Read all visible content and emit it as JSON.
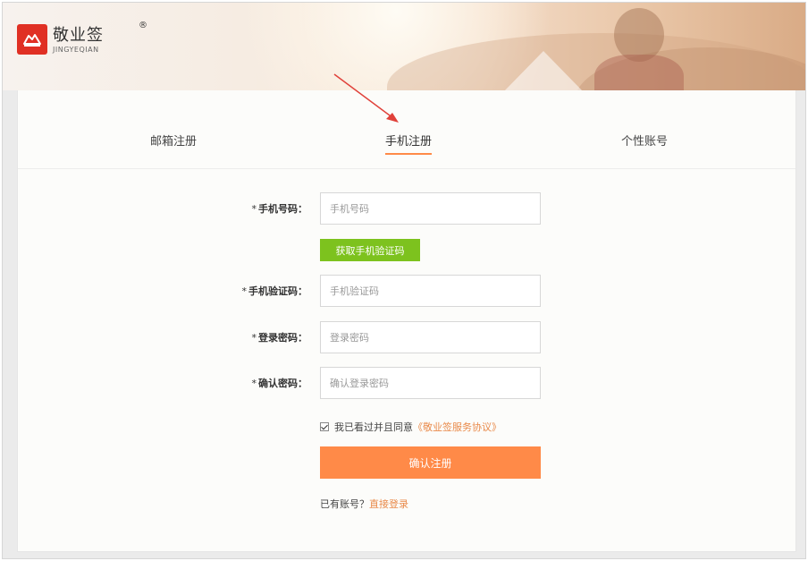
{
  "brand": {
    "name": "敬业签",
    "reg_mark": "®",
    "sub": "JINGYEQIAN",
    "color": "#e03024"
  },
  "tabs": [
    {
      "label": "邮箱注册",
      "active": false
    },
    {
      "label": "手机注册",
      "active": true
    },
    {
      "label": "个性账号",
      "active": false
    }
  ],
  "form": {
    "required_mark": "*",
    "phone": {
      "label": "手机号码：",
      "placeholder": "手机号码"
    },
    "get_code_label": "获取手机验证码",
    "code": {
      "label": "手机验证码：",
      "placeholder": "手机验证码"
    },
    "password": {
      "label": "登录密码：",
      "placeholder": "登录密码"
    },
    "confirm": {
      "label": "确认密码：",
      "placeholder": "确认登录密码"
    },
    "agree_text": "我已看过并且同意",
    "agree_link": "《敬业签服务协议》",
    "agree_checked": true,
    "submit_label": "确认注册",
    "have_account": "已有账号？",
    "login_link": "直接登录"
  },
  "colors": {
    "accent": "#ff8a48",
    "green": "#7dc21e",
    "link": "#e98a4a",
    "arrow": "#e0413a"
  }
}
